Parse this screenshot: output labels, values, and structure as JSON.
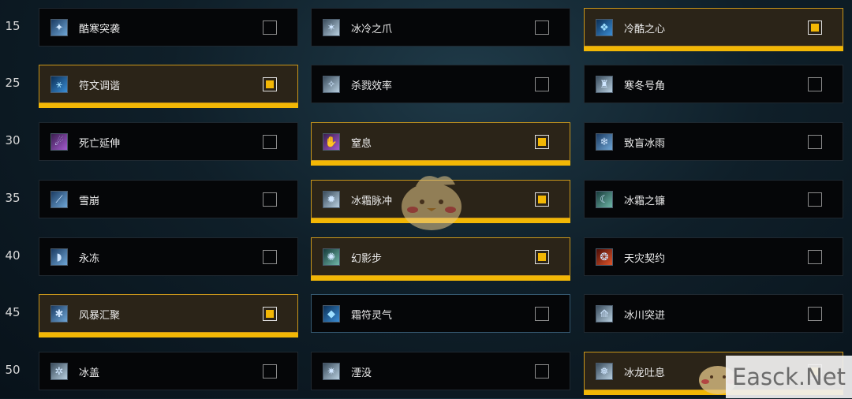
{
  "colors": {
    "accent": "#f2b705",
    "selected_bg": "#2b2418",
    "card_bg": "#050608"
  },
  "rows": [
    {
      "level": "15",
      "talents": [
        {
          "name": "酷寒突袭",
          "icon": "frost-strike-icon",
          "style": "frost",
          "glyph": "✦",
          "checked": false
        },
        {
          "name": "冰冷之爪",
          "icon": "frozen-claw-icon",
          "style": "pale",
          "glyph": "✶",
          "checked": false
        },
        {
          "name": "冷酷之心",
          "icon": "cold-heart-icon",
          "style": "rune",
          "glyph": "❖",
          "checked": true
        }
      ]
    },
    {
      "level": "25",
      "talents": [
        {
          "name": "符文调谐",
          "icon": "rune-attunement-icon",
          "style": "rune",
          "glyph": "⚹",
          "checked": true
        },
        {
          "name": "杀戮效率",
          "icon": "murderous-efficiency-icon",
          "style": "pale",
          "glyph": "✧",
          "checked": false
        },
        {
          "name": "寒冬号角",
          "icon": "horn-of-winter-icon",
          "style": "pale",
          "glyph": "♜",
          "checked": false
        }
      ]
    },
    {
      "level": "30",
      "talents": [
        {
          "name": "死亡延伸",
          "icon": "deaths-reach-icon",
          "style": "purple",
          "glyph": "☄",
          "checked": false
        },
        {
          "name": "窒息",
          "icon": "asphyxiate-icon",
          "style": "purple",
          "glyph": "✋",
          "checked": true
        },
        {
          "name": "致盲冰雨",
          "icon": "blinding-sleet-icon",
          "style": "frost",
          "glyph": "❄",
          "checked": false
        }
      ]
    },
    {
      "level": "35",
      "talents": [
        {
          "name": "雪崩",
          "icon": "avalanche-icon",
          "style": "frost",
          "glyph": "⟋",
          "checked": false
        },
        {
          "name": "冰霜脉冲",
          "icon": "frostwyrm-pulse-icon",
          "style": "pale",
          "glyph": "✹",
          "checked": true
        },
        {
          "name": "冰霜之镰",
          "icon": "frostscythe-icon",
          "style": "teal",
          "glyph": "☾",
          "checked": false
        }
      ]
    },
    {
      "level": "40",
      "talents": [
        {
          "name": "永冻",
          "icon": "permafrost-icon",
          "style": "frost",
          "glyph": "◗",
          "checked": false
        },
        {
          "name": "幻影步",
          "icon": "wraith-walk-icon",
          "style": "teal",
          "glyph": "✺",
          "checked": true
        },
        {
          "name": "天灾契约",
          "icon": "death-pact-icon",
          "style": "fire",
          "glyph": "❂",
          "checked": false
        }
      ]
    },
    {
      "level": "45",
      "talents": [
        {
          "name": "风暴汇聚",
          "icon": "gathering-storm-icon",
          "style": "frost",
          "glyph": "✱",
          "checked": true
        },
        {
          "name": "霜符灵气",
          "icon": "hungering-rune-weapon-icon",
          "style": "rune",
          "glyph": "◆",
          "checked": false,
          "hover": true
        },
        {
          "name": "冰川突进",
          "icon": "glacial-advance-icon",
          "style": "pale",
          "glyph": "⟰",
          "checked": false
        }
      ]
    },
    {
      "level": "50",
      "talents": [
        {
          "name": "冰盖",
          "icon": "icecap-icon",
          "style": "pale",
          "glyph": "✲",
          "checked": false
        },
        {
          "name": "湮没",
          "icon": "obliteration-icon",
          "style": "pale",
          "glyph": "✷",
          "checked": false
        },
        {
          "name": "冰龙吐息",
          "icon": "breath-of-sindragosa-icon",
          "style": "pale",
          "glyph": "❅",
          "checked": true
        }
      ]
    }
  ],
  "watermark": {
    "text": "Easck.Net"
  }
}
